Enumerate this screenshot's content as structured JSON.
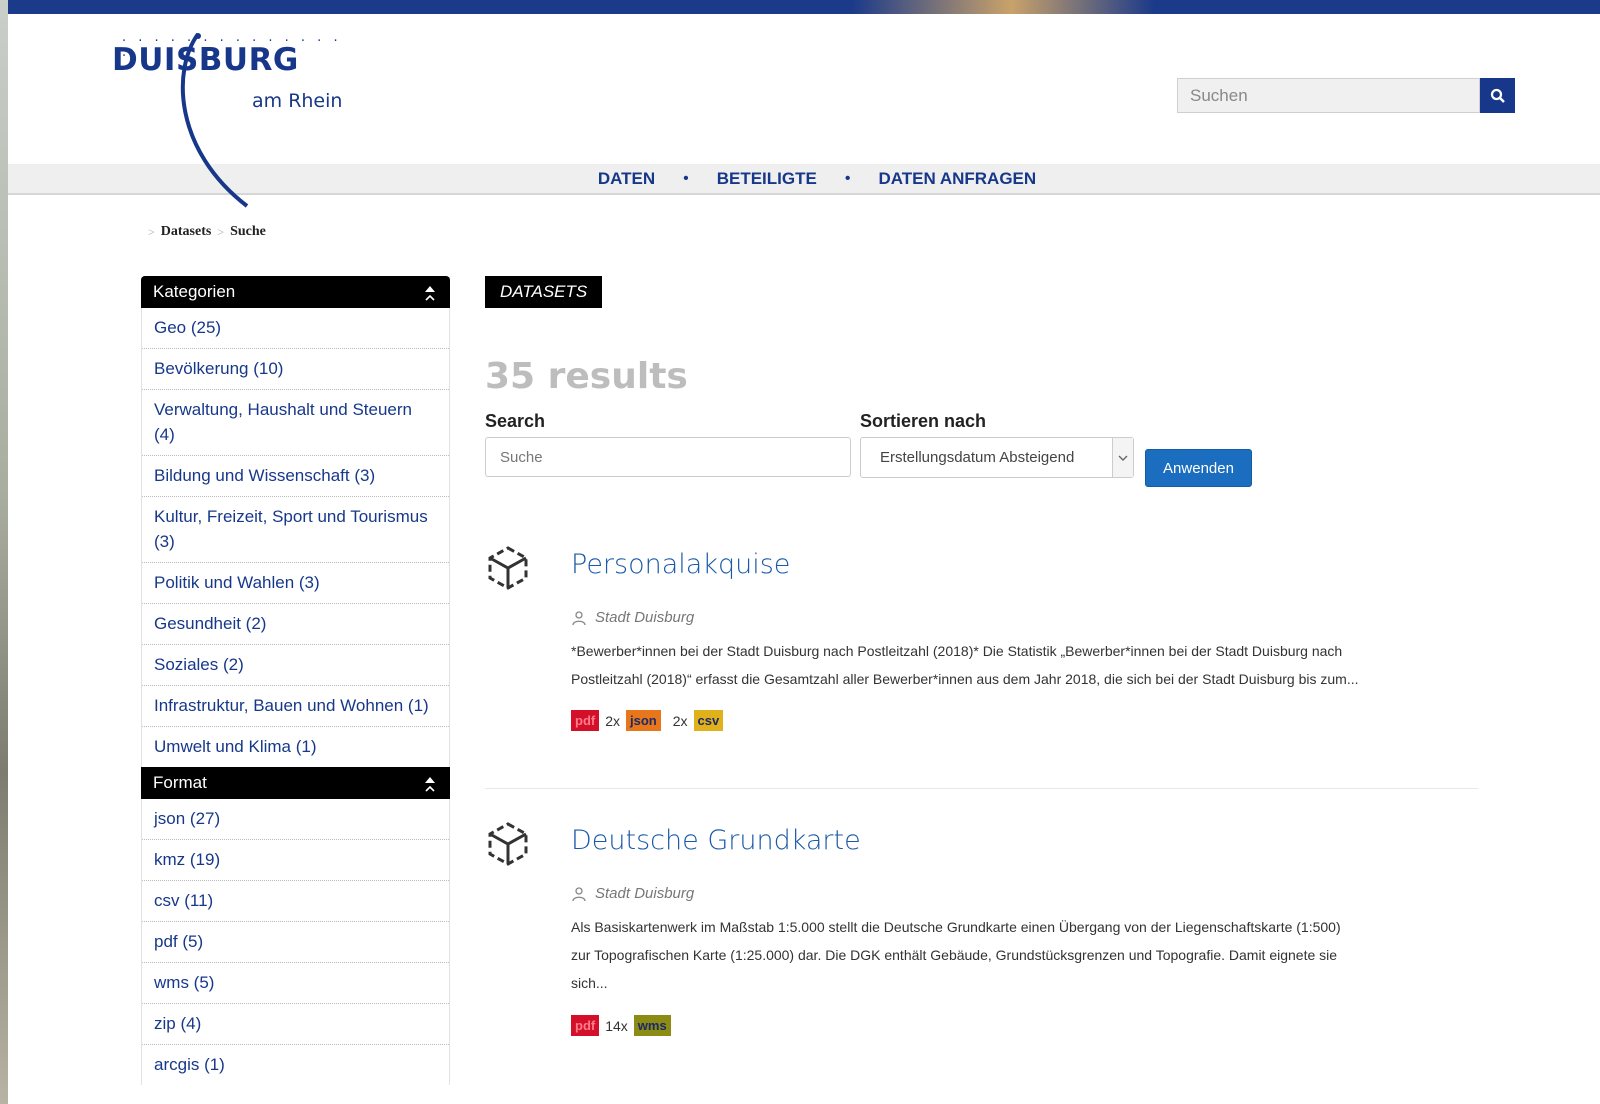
{
  "logo": {
    "dots": ". . . . . . . . . . . . . . .",
    "word": "DUISBURG",
    "sub": "am Rhein"
  },
  "header_search": {
    "placeholder": "Suchen"
  },
  "nav": {
    "items": [
      "DATEN",
      "BETEILIGTE",
      "DATEN ANFRAGEN"
    ],
    "separator": "•"
  },
  "breadcrumb": {
    "items": [
      "Datasets",
      "Suche"
    ],
    "separator": ">"
  },
  "sidebar": {
    "categories": {
      "title": "Kategorien",
      "items": [
        "Geo (25)",
        "Bevölkerung (10)",
        "Verwaltung, Haushalt und Steuern (4)",
        "Bildung und Wissenschaft (3)",
        "Kultur, Freizeit, Sport und Tourismus (3)",
        "Politik und Wahlen (3)",
        "Gesundheit (2)",
        "Soziales (2)",
        "Infrastruktur, Bauen und Wohnen (1)",
        "Umwelt und Klima (1)"
      ]
    },
    "format": {
      "title": "Format",
      "items": [
        "json (27)",
        "kmz (19)",
        "csv (11)",
        "pdf (5)",
        "wms (5)",
        "zip (4)",
        "arcgis (1)"
      ]
    }
  },
  "main": {
    "tag": "DATASETS",
    "results": "35 results",
    "search_label": "Search",
    "search_placeholder": "Suche",
    "sort_label": "Sortieren nach",
    "sort_value": "Erstellungsdatum Absteigend",
    "apply_label": "Anwenden"
  },
  "datasets": [
    {
      "title": "Personalakquise",
      "org": "Stadt Duisburg",
      "desc_line1": "*Bewerber*innen bei der Stadt Duisburg nach Postleitzahl (2018)* Die Statistik „Bewerber*innen bei der Stadt Duisburg nach",
      "desc_line2": "Postleitzahl (2018)“ erfasst die Gesamtzahl aller Bewerber*innen aus dem Jahr 2018, die sich bei der Stadt Duisburg bis zum...",
      "fmt1": "pdf",
      "count1": "2x",
      "fmt2": "json",
      "count2": "2x",
      "fmt3": "csv"
    },
    {
      "title": "Deutsche Grundkarte",
      "org": "Stadt Duisburg",
      "desc_line1": "Als Basiskartenwerk im Maßstab 1:5.000 stellt die Deutsche Grundkarte einen Übergang von der Liegenschaftskarte (1:500)",
      "desc_line2": "zur Topografischen Karte (1:25.000) dar. Die DGK enthält Gebäude, Grundstücksgrenzen und Topografie. Damit eignete sie",
      "desc_line3": "sich...",
      "fmt1": "pdf",
      "count1": "14x",
      "fmt2": "wms"
    }
  ],
  "colors": {
    "brand": "#17388a",
    "link": "#1a5aa8",
    "button": "#1a6dbf"
  }
}
